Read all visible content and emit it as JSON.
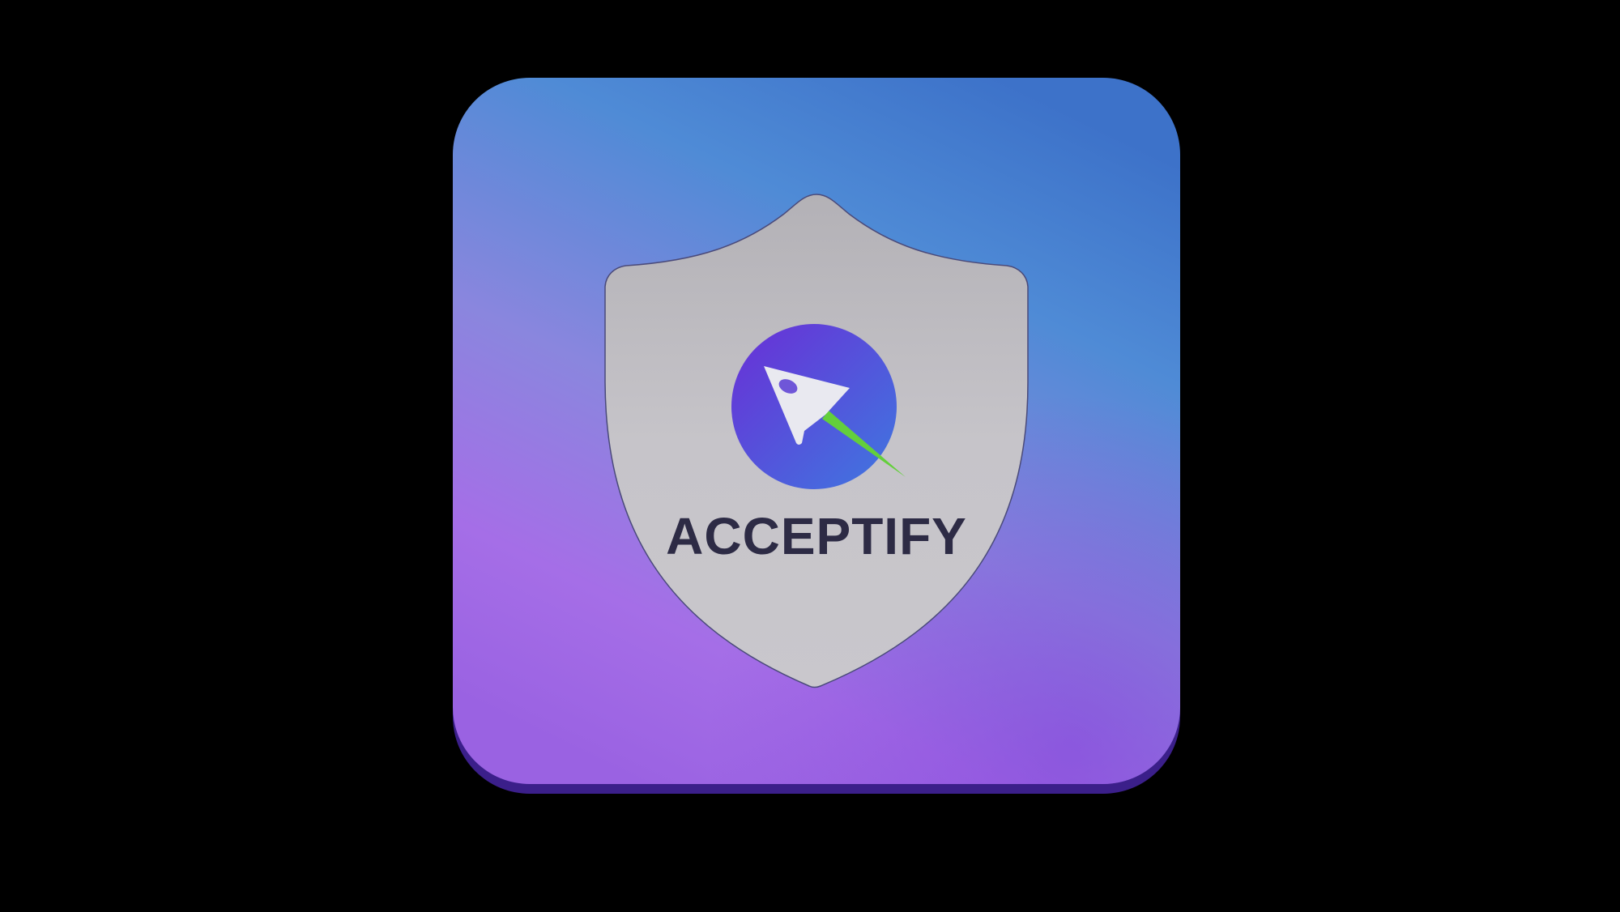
{
  "icon": {
    "brand_name": "ACCEPTIFY",
    "tile_gradient": {
      "top": "#3f7fd2",
      "middle": "#7a8ad8",
      "bottom": "#a46fe6"
    },
    "shield_color": "#c4c2c7",
    "emblem_gradient": {
      "start": "#6a2ed6",
      "end": "#3e78e0"
    },
    "rocket_color": "#e9e9f0",
    "trail_color": "#63cf3b",
    "text_color": "#2d2b45",
    "background": "#000000"
  }
}
